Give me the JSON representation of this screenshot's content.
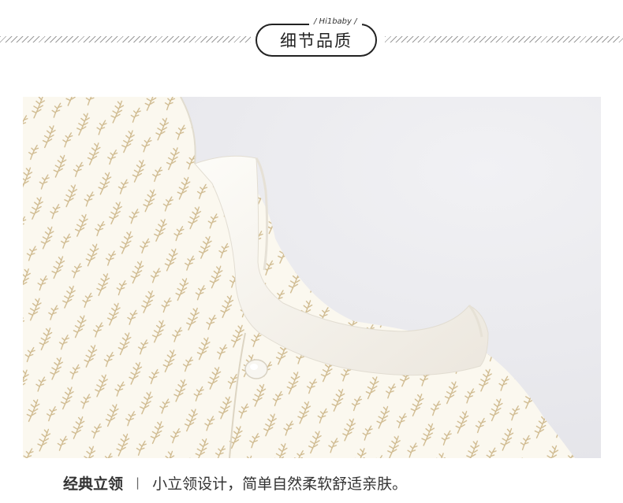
{
  "header": {
    "brand": "/ Hi1baby /",
    "title": "细节品质"
  },
  "photo": {
    "subject": "baby garment collar close-up",
    "colors": {
      "background": "#ececf0",
      "fabric": "#fbf8ef",
      "leaf": "#cdb78a",
      "rib": "#f7f4ee"
    }
  },
  "caption": {
    "title": "经典立领",
    "separator": "|",
    "description": "小立领设计，简单自然柔软舒适亲肤。"
  }
}
